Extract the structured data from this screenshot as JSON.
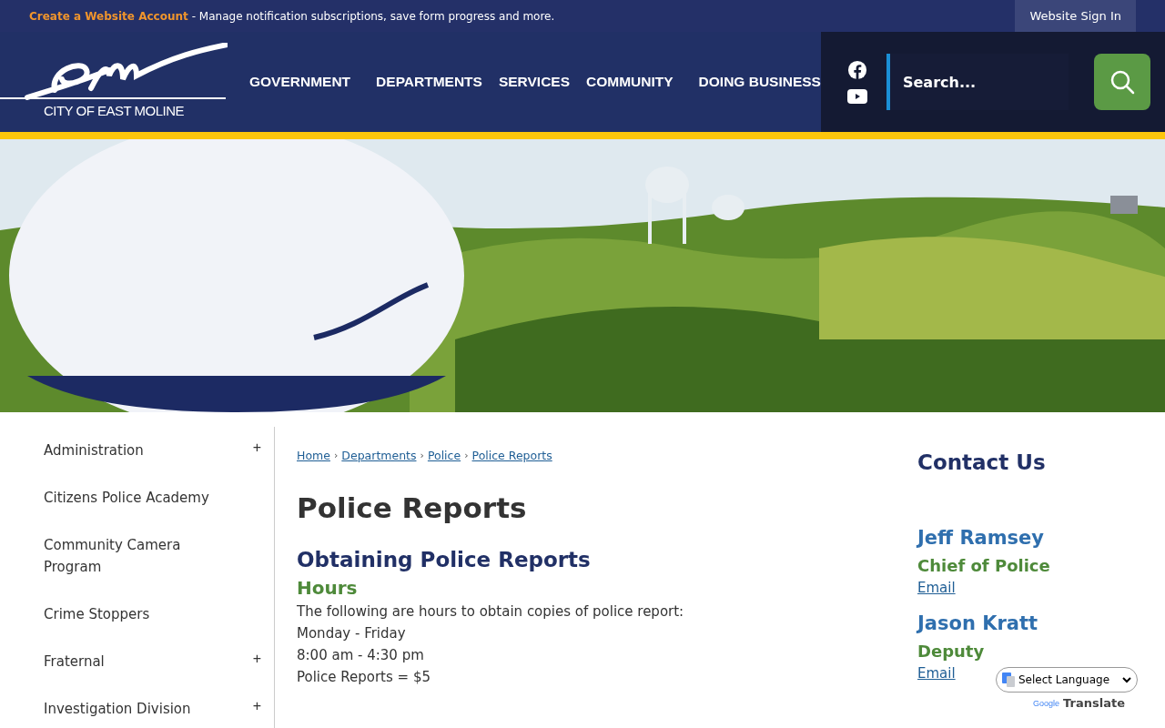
{
  "top_bar": {
    "link": "Create a Website Account",
    "text": "- Manage notification subscriptions, save form progress and more.",
    "sign_in": "Website Sign In"
  },
  "header": {
    "logo_text": "CITY OF EAST MOLINE",
    "nav": [
      "GOVERNMENT",
      "DEPARTMENTS",
      "SERVICES",
      "COMMUNITY",
      "DOING BUSINESS"
    ],
    "search": {
      "placeholder": "Search..."
    }
  },
  "hero": {
    "kind": "picture"
  },
  "sidebar": {
    "items": [
      {
        "label": "Administration",
        "toggle": "+"
      },
      {
        "label": "Citizens Police Academy"
      },
      {
        "label": "Community Camera Program"
      },
      {
        "label": "Crime Stoppers"
      },
      {
        "label": "Fraternal",
        "toggle": "+"
      },
      {
        "label": "Investigation Division",
        "toggle": "+"
      }
    ]
  },
  "breadcrumbs": [
    "Home",
    "Departments",
    "Police",
    "Police Reports"
  ],
  "breadcrumb_separator": "›",
  "title": "Police Reports",
  "section": {
    "heading": "Obtaining Police Reports",
    "subheading": "Hours",
    "lines": [
      "The following are hours to obtain copies of police report:",
      "Monday - Friday",
      "8:00 am - 4:30 pm",
      "Police Reports = $5"
    ]
  },
  "contact": {
    "heading": "Contact Us",
    "people": [
      {
        "name": "Jeff Ramsey",
        "role": "Chief of Police",
        "link": "Email"
      },
      {
        "name": "Jason Kratt",
        "role": "Deputy",
        "link": "Email"
      }
    ]
  },
  "translate": {
    "select": "Select Language",
    "brand": "Google",
    "label": "Translate"
  }
}
